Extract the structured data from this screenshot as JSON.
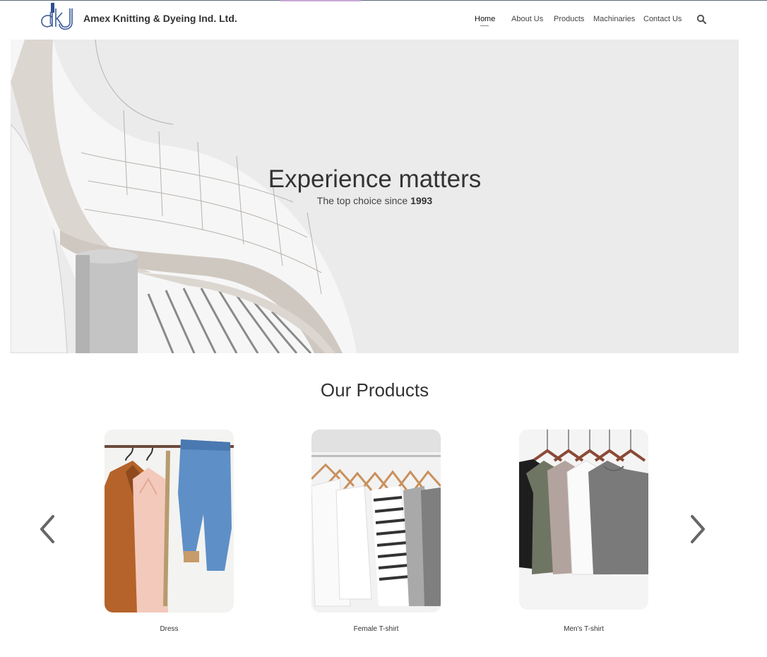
{
  "brand": {
    "logo_text": "dkj",
    "name": "Amex Knitting & Dyeing Ind. Ltd."
  },
  "nav": {
    "items": [
      {
        "label": "Home",
        "active": true
      },
      {
        "label": "About Us"
      },
      {
        "label": "Products"
      },
      {
        "label": "Machinaries"
      },
      {
        "label": "Contact Us"
      }
    ],
    "search_icon": "search-icon"
  },
  "hero": {
    "title": "Experience matters",
    "subtitle_prefix": "The top choice since",
    "subtitle_year": "1993"
  },
  "products": {
    "title": "Our Products",
    "prev_icon": "chevron-left-icon",
    "next_icon": "chevron-right-icon",
    "items": [
      {
        "label": "Dress"
      },
      {
        "label": "Female T-shirt"
      },
      {
        "label": "Men's T-shirt"
      }
    ]
  },
  "colors": {
    "accent_logo": "#2f4f8f",
    "text": "#333333",
    "hero_bg": "#e9e9ea"
  }
}
